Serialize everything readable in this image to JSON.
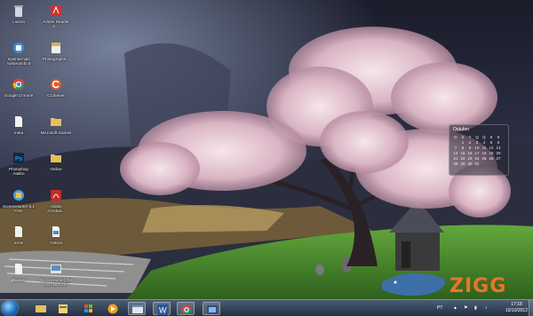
{
  "desktop_icons": [
    {
      "name": "recycle-bin",
      "label": "Lixeira"
    },
    {
      "name": "adobe-reader",
      "label": "Adobe Reader\nX...."
    },
    {
      "name": "sysinternals",
      "label": "Sysinternals\nSystemInfo 5"
    },
    {
      "name": "photographers",
      "label": "Photographs..."
    },
    {
      "name": "google-chrome",
      "label": "Google Chrome"
    },
    {
      "name": "ccleaner",
      "label": "CCleaner"
    },
    {
      "name": "meta-file",
      "label": "meta"
    },
    {
      "name": "microsoft-games",
      "label": "Microsoft Games"
    },
    {
      "name": "photoshop",
      "label": "Photoshop\nAtalho"
    },
    {
      "name": "online-folder",
      "label": "Online"
    },
    {
      "name": "screenhunter",
      "label": "ScreenHunter 5.1\nFree"
    },
    {
      "name": "adobe-acrobat",
      "label": "Adobe\nAcrobat..."
    },
    {
      "name": "erros-file",
      "label": "erros"
    },
    {
      "name": "outros-file",
      "label": "Outros"
    },
    {
      "name": "pastas-folder",
      "label": "Pastas"
    },
    {
      "name": "screenhunter-file",
      "label": "ScreenHunter_04\nOct. 15 17.17"
    }
  ],
  "gadget": {
    "month": "Outubro",
    "days_header": [
      "D",
      "S",
      "T",
      "Q",
      "Q",
      "S",
      "S"
    ],
    "weeks": [
      [
        "",
        "1",
        "2",
        "3",
        "4",
        "5",
        "6"
      ],
      [
        "7",
        "8",
        "9",
        "10",
        "11",
        "12",
        "13"
      ],
      [
        "14",
        "15",
        "16",
        "17",
        "18",
        "19",
        "20"
      ],
      [
        "21",
        "22",
        "23",
        "24",
        "25",
        "26",
        "27"
      ],
      [
        "28",
        "29",
        "30",
        "31",
        "",
        "",
        ""
      ]
    ]
  },
  "taskbar": {
    "pinned": [
      {
        "name": "explorer",
        "active": false
      },
      {
        "name": "library",
        "active": false
      },
      {
        "name": "windows7",
        "active": false
      },
      {
        "name": "media-player",
        "active": false
      },
      {
        "name": "window",
        "active": true
      },
      {
        "name": "word",
        "active": true
      },
      {
        "name": "chrome",
        "active": true
      },
      {
        "name": "screenshot",
        "active": true
      }
    ],
    "tray_lang": "PT",
    "clock_time": "17:18",
    "clock_date": "15/10/2012"
  },
  "watermark": {
    "text": "ZIGG"
  },
  "colors": {
    "accent": "#e8752a",
    "taskbar": "#2b3a4e"
  }
}
